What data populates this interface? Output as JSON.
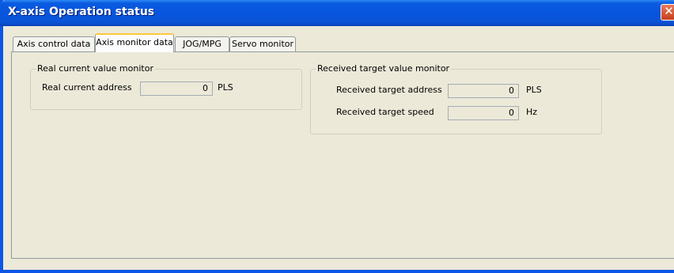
{
  "window": {
    "title": "X-axis Operation status",
    "close_glyph": "✕"
  },
  "tabs": [
    {
      "label": "Axis control data",
      "active": false
    },
    {
      "label": "Axis monitor data",
      "active": true
    },
    {
      "label": "JOG/MPG",
      "active": false
    },
    {
      "label": "Servo monitor",
      "active": false
    }
  ],
  "real_current": {
    "legend": "Real current value monitor",
    "address_label": "Real current address",
    "address_value": "0",
    "address_unit": "PLS"
  },
  "received_target": {
    "legend": "Received target value monitor",
    "address_label": "Received target address",
    "address_value": "0",
    "address_unit": "PLS",
    "speed_label": "Received target speed",
    "speed_value": "0",
    "speed_unit": "Hz"
  },
  "icons": {
    "close": "close-icon"
  },
  "colors": {
    "titlebar": "#0755de",
    "window_bg": "#ece9d8",
    "active_tab_highlight": "#ffc83c",
    "close_button": "#c6401e"
  }
}
